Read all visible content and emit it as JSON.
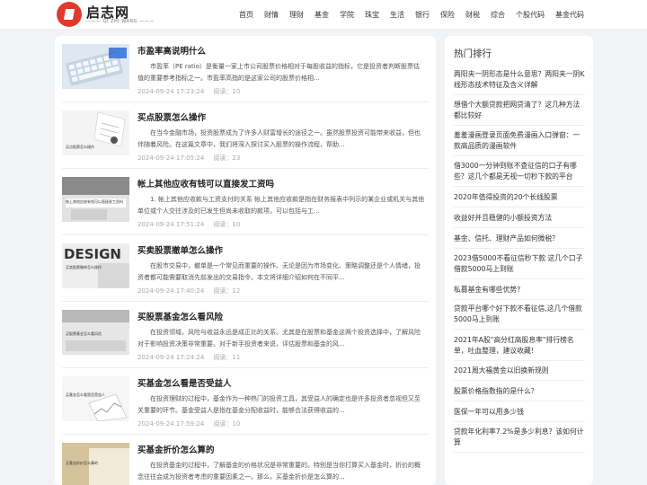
{
  "logo": {
    "name": "启志网",
    "sub": "——— QI ZHI WANG ———"
  },
  "nav": [
    "首页",
    "财情",
    "理财",
    "基金",
    "学院",
    "珠宝",
    "生活",
    "银行",
    "保险",
    "财税",
    "综合",
    "个股代码",
    "基金代码"
  ],
  "articles": [
    {
      "title": "市盈率高说明什么",
      "summary": "市盈率（PE ratio）是衡量一家上市公司股票价格相对于每股收益的指标，它是投资者判断股票估值的重要参考指标之一。市盈率高指的是这家公司的股票价格相...",
      "date": "2024-09-24 17:23:24",
      "reads": "阅读：10",
      "thumb_text": ""
    },
    {
      "title": "买点股票怎么操作",
      "summary": "在当今金融市场，投资股票成为了许多人财富增长的途径之一。虽然股票投资可能带来收益，但也伴随着风险。在这篇文章中，我们将深入探讨买入股票的操作流程，帮助...",
      "date": "2024-09-24 17:05:24",
      "reads": "阅读：23",
      "thumb_text": "买点股票怎么操作"
    },
    {
      "title": "帐上其他应收有钱可以直接发工资吗",
      "summary": "1. 帐上其他应收款与工资支付的关系 帐上其他应收款是指在财务报表中列示的某企业或机关与其他单位或个人交往涉及的已发生但尚未收取的款项，可以包括与工...",
      "date": "2024-09-24 17:51:24",
      "reads": "阅读：10",
      "thumb_text": "帐上其他应收有钱可以直接发工资吗"
    },
    {
      "title": "买卖股票撤单怎么操作",
      "summary": "在股市交易中，撤单是一个常见而重要的操作。无论是因为市场变化、策略调整还是个人情绪，投资者都可能需要取消先前发出的交易指令。本文将详细介绍如何在不同平...",
      "date": "2024-09-24 17:40:24",
      "reads": "阅读：12",
      "thumb_text": "买卖股票撤单怎么操作"
    },
    {
      "title": "买股票基金怎么看风险",
      "summary": "在投资领域，风险与收益永远是成正比的关系。尤其是在股票和基金这两个投资选择中，了解风险对于影响投资决策非常重要。对于新手投资者来说，评估股票和基金的风...",
      "date": "2024-09-24 17:24:24",
      "reads": "阅读：11",
      "thumb_text": "买股票基金怎么看风险"
    },
    {
      "title": "买基金怎么看是否受益人",
      "summary": "在投资理财的过程中，基金作为一种热门的投资工具，其受益人的确定也是许多投资者忽视但又至关重要的环节。基金受益人是指在基金分配收益时，能够合法获得收益的...",
      "date": "2024-09-24 17:59:24",
      "reads": "阅读：10",
      "thumb_text": "买基金怎么看是否受益人"
    },
    {
      "title": "买基金折价怎么算的",
      "summary": "在投资基金的过程中，了解基金的价格状况是非常重要的。特别是当你打算买入基金时，折价的概念往往会成为投资者考虑的重要因素之一。那么，买基金折价是怎么算的...",
      "date": "",
      "reads": "",
      "thumb_text": "买基金折价怎么算的"
    }
  ],
  "side": {
    "title": "热门排行",
    "items": [
      "两阳夹一阴形态是什么意思？两阳夹一阴K线形态技术特征及含义详解",
      "想借个大额贷款把网贷清了？这几种方法都比较好",
      "羞羞漫画登录页面免费漫画入口弹窗：一款高品质的漫画软件",
      "借3000一分钟到账不查征信的口子有哪些？这几个都是无视一切秒下款的平台",
      "2020年值得投资的20个长线股票",
      "收益好并且稳健的小额投资方法",
      "基金、信托、理财产品如何微税？",
      "2023借5000不看征信秒下款 这几个口子借款5000马上到账",
      "私募基金有哪些优势?",
      "贷款平台哪个好下款不看征信,这几个借款5000马上到账",
      "2021年A股\"高分红高股息率\"排行榜名单，吐血整理，建议收藏！",
      "2021周大福黄金以旧换新规则",
      "股票价格指数指的是什么？",
      "医保一年可以用多少钱",
      "贷款年化利率7.2%是多少利息？该如何计算"
    ]
  }
}
